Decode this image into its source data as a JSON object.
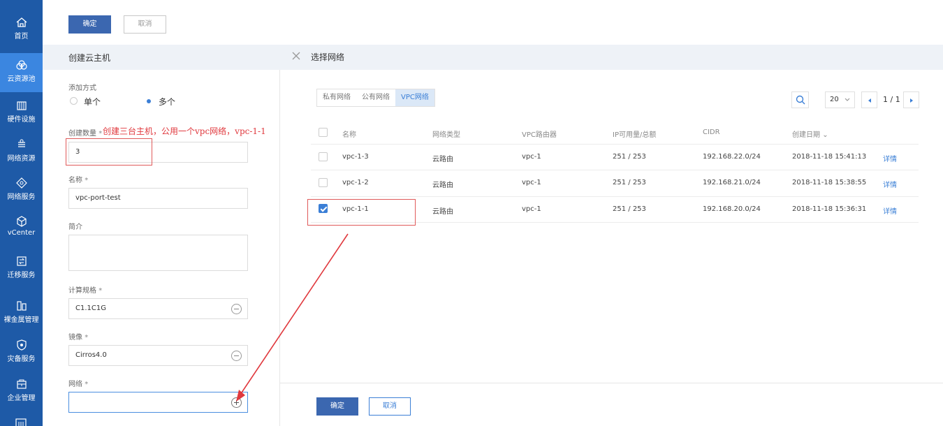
{
  "sidebar": {
    "items": [
      {
        "label": "首页",
        "icon": "home-icon"
      },
      {
        "label": "云资源池",
        "icon": "resource-pool-icon",
        "active": true
      },
      {
        "label": "硬件设施",
        "icon": "hardware-icon"
      },
      {
        "label": "网络资源",
        "icon": "network-resource-icon"
      },
      {
        "label": "网络服务",
        "icon": "network-service-icon"
      },
      {
        "label": "vCenter",
        "icon": "vcenter-icon"
      },
      {
        "label": "迁移服务",
        "icon": "migration-icon"
      },
      {
        "label": "裸金属管理",
        "icon": "bare-metal-icon"
      },
      {
        "label": "灾备服务",
        "icon": "disaster-recovery-icon"
      },
      {
        "label": "企业管理",
        "icon": "enterprise-icon"
      }
    ],
    "colors": {
      "bg": "#1e5aa7",
      "active": "#3b86e0"
    }
  },
  "toolbar": {
    "confirm_label": "确定",
    "cancel_label": "取消"
  },
  "form": {
    "title": "创建云主机",
    "add_mode_label": "添加方式",
    "add_mode_options": [
      "单个",
      "多个"
    ],
    "add_mode_selected": "多个",
    "count_label": "创建数量",
    "count_value": "3",
    "annotation": "创建三台主机，公用一个vpc网络，vpc-1-1",
    "name_label": "名称",
    "name_value": "vpc-port-test",
    "desc_label": "简介",
    "desc_value": "",
    "spec_label": "计算规格",
    "spec_value": "C1.1C1G",
    "image_label": "镜像",
    "image_value": "Cirros4.0",
    "network_label": "网络",
    "network_value": "",
    "required_mark": "*"
  },
  "network_panel": {
    "title": "选择网络",
    "tabs": [
      "私有网络",
      "公有网络",
      "VPC网络"
    ],
    "active_tab": "VPC网络",
    "page_size": "20",
    "pagination": "1 / 1",
    "columns": [
      "名称",
      "网络类型",
      "VPC路由器",
      "IP可用量/总额",
      "CIDR",
      "创建日期"
    ],
    "sort_indicator": "⌄",
    "rows": [
      {
        "name": "vpc-1-3",
        "type": "云路由",
        "router": "vpc-1",
        "ip": "251 / 253",
        "cidr": "192.168.22.0/24",
        "date": "2018-11-18 15:41:13",
        "link": "详情",
        "checked": false
      },
      {
        "name": "vpc-1-2",
        "type": "云路由",
        "router": "vpc-1",
        "ip": "251 / 253",
        "cidr": "192.168.21.0/24",
        "date": "2018-11-18 15:38:55",
        "link": "详情",
        "checked": false
      },
      {
        "name": "vpc-1-1",
        "type": "云路由",
        "router": "vpc-1",
        "ip": "251 / 253",
        "cidr": "192.168.20.0/24",
        "date": "2018-11-18 15:36:31",
        "link": "详情",
        "checked": true
      }
    ],
    "confirm_label": "确定",
    "cancel_label": "取消"
  },
  "colors": {
    "primary": "#3b67b0",
    "link": "#3b7fd6",
    "annotation": "#e0393e",
    "header_bg": "#eef2f7"
  }
}
